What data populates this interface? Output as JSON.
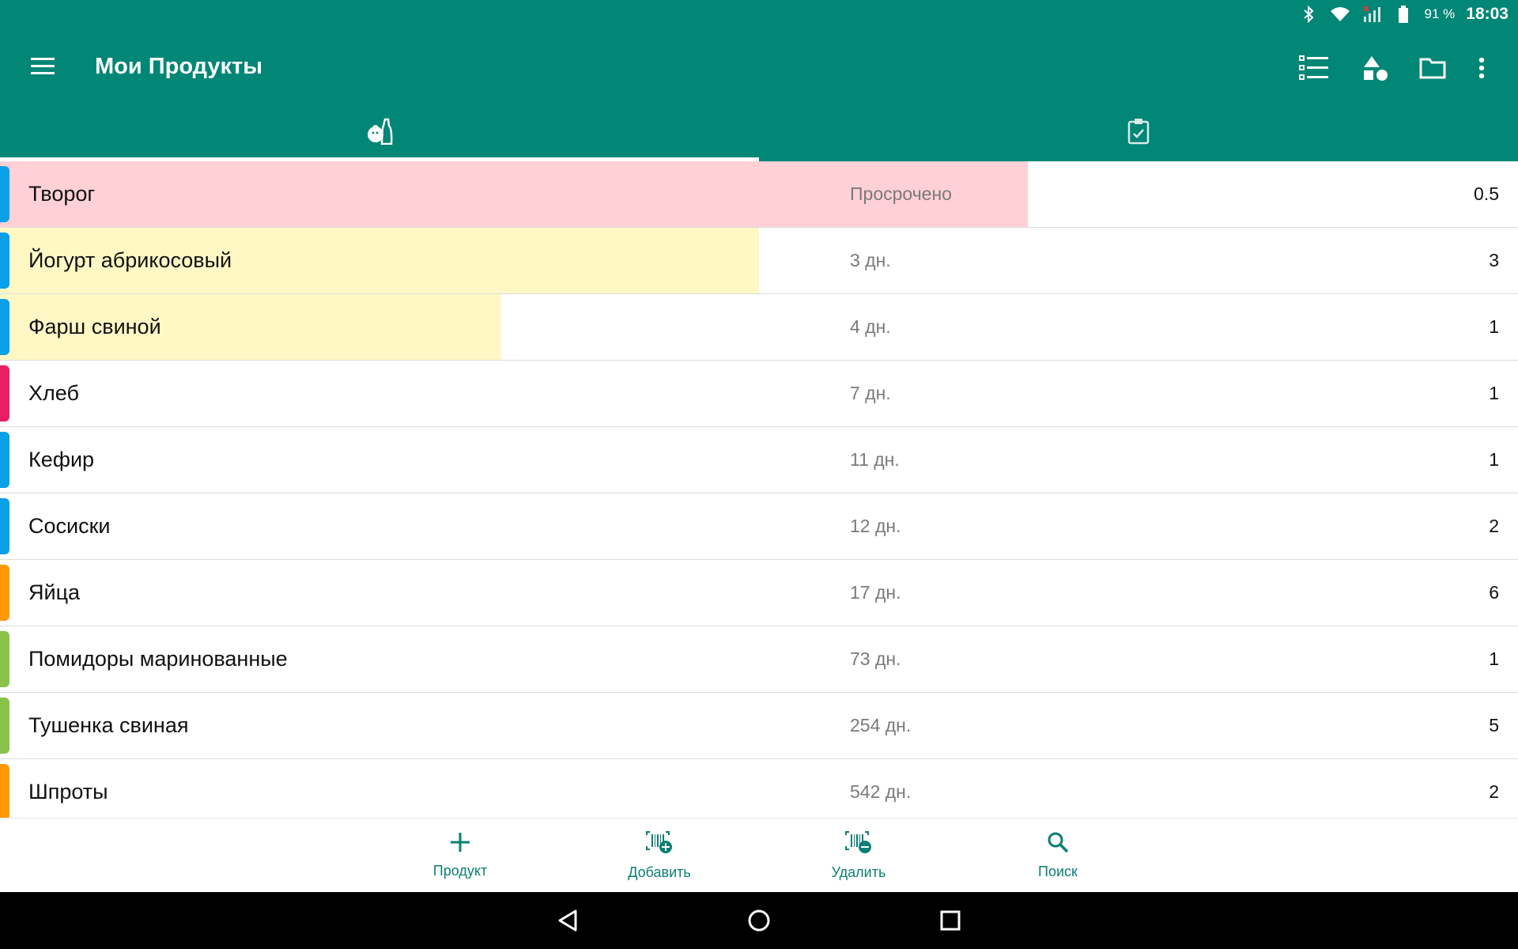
{
  "status_bar": {
    "icons": [
      "bluetooth-icon",
      "wifi-icon",
      "signal-icon",
      "battery-icon"
    ],
    "battery_percent": "91 %",
    "time": "18:03"
  },
  "app_bar": {
    "title": "Мои Продукты",
    "menu_icon": "hamburger-menu-icon",
    "actions": [
      "list-view-icon",
      "categories-icon",
      "folder-icon",
      "more-vert-icon"
    ]
  },
  "tabs": [
    {
      "icon": "products-icon",
      "selected": true
    },
    {
      "icon": "checklist-icon",
      "selected": false
    }
  ],
  "colors": {
    "primary": "#028676",
    "expired_row": "#ffd0d6",
    "soon_row": "#fff8c5",
    "blue": "#0aa0e8",
    "pink": "#e91e63",
    "orange": "#ff9800",
    "green": "#8bc34a"
  },
  "products": [
    {
      "name": "Творог",
      "expiry": "Просрочено",
      "qty": "0.5",
      "category_color": "#0aa0e8",
      "highlight": "#ffd0d6",
      "highlight_fraction": 0.677
    },
    {
      "name": "Йогурт абрикосовый",
      "expiry": "3 дн.",
      "qty": "3",
      "category_color": "#0aa0e8",
      "highlight": "#fff8c5",
      "highlight_fraction": 0.5
    },
    {
      "name": "Фарш свиной",
      "expiry": "4 дн.",
      "qty": "1",
      "category_color": "#0aa0e8",
      "highlight": "#fff8c5",
      "highlight_fraction": 0.33
    },
    {
      "name": "Хлеб",
      "expiry": "7 дн.",
      "qty": "1",
      "category_color": "#e91e63",
      "highlight": "",
      "highlight_fraction": 0
    },
    {
      "name": "Кефир",
      "expiry": "11 дн.",
      "qty": "1",
      "category_color": "#0aa0e8",
      "highlight": "",
      "highlight_fraction": 0
    },
    {
      "name": "Сосиски",
      "expiry": "12 дн.",
      "qty": "2",
      "category_color": "#0aa0e8",
      "highlight": "",
      "highlight_fraction": 0
    },
    {
      "name": "Яйца",
      "expiry": "17 дн.",
      "qty": "6",
      "category_color": "#ff9800",
      "highlight": "",
      "highlight_fraction": 0
    },
    {
      "name": "Помидоры маринованные",
      "expiry": "73 дн.",
      "qty": "1",
      "category_color": "#8bc34a",
      "highlight": "",
      "highlight_fraction": 0
    },
    {
      "name": "Тушенка свиная",
      "expiry": "254 дн.",
      "qty": "5",
      "category_color": "#8bc34a",
      "highlight": "",
      "highlight_fraction": 0
    },
    {
      "name": "Шпроты",
      "expiry": "542 дн.",
      "qty": "2",
      "category_color": "#ff9800",
      "highlight": "",
      "highlight_fraction": 0
    }
  ],
  "bottom_bar": {
    "product_label": "Продукт",
    "add_label": "Добавить",
    "remove_label": "Удалить",
    "search_label": "Поиск"
  },
  "nav_bar": [
    "back-icon",
    "home-icon",
    "recents-icon"
  ]
}
